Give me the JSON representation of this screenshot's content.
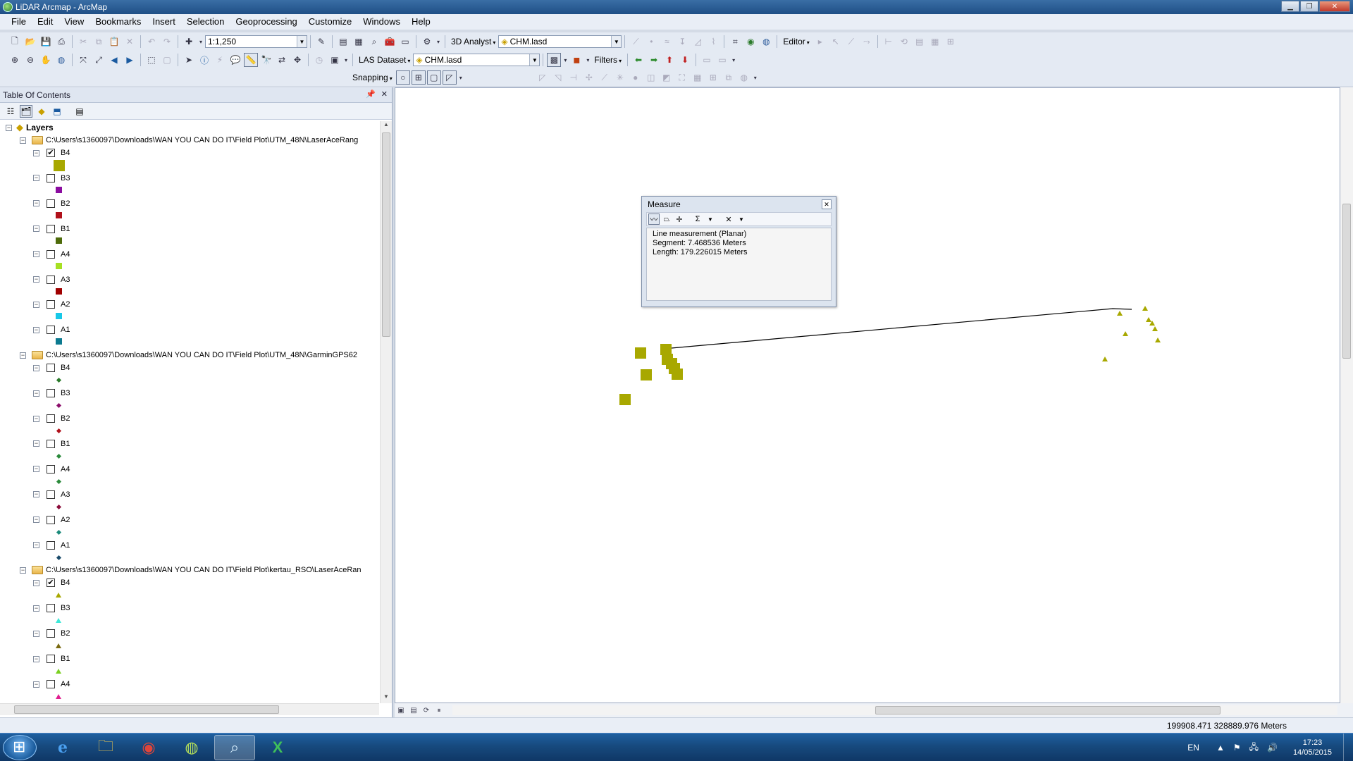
{
  "window": {
    "title": "LiDAR Arcmap - ArcMap"
  },
  "menubar": [
    "File",
    "Edit",
    "View",
    "Bookmarks",
    "Insert",
    "Selection",
    "Geoprocessing",
    "Customize",
    "Windows",
    "Help"
  ],
  "toolbar": {
    "scale": "1:1,250",
    "analyst_label": "3D Analyst",
    "analyst_layer": "CHM.lasd",
    "editor_label": "Editor",
    "las_label": "LAS Dataset",
    "las_layer": "CHM.lasd",
    "filters_label": "Filters",
    "snapping_label": "Snapping"
  },
  "toc": {
    "title": "Table Of Contents",
    "root": "Layers",
    "groups": [
      {
        "path": "C:\\Users\\s1360097\\Downloads\\WAN YOU CAN DO IT\\Field Plot\\UTM_48N\\LaserAceRang",
        "symbol": "square",
        "layers": [
          {
            "name": "B4",
            "checked": true,
            "color": "#a8a800",
            "big": true
          },
          {
            "name": "B3",
            "checked": false,
            "color": "#8b0ca0"
          },
          {
            "name": "B2",
            "checked": false,
            "color": "#b0101a"
          },
          {
            "name": "B1",
            "checked": false,
            "color": "#4e6b0a"
          },
          {
            "name": "A4",
            "checked": false,
            "color": "#a6e022"
          },
          {
            "name": "A3",
            "checked": false,
            "color": "#a00000"
          },
          {
            "name": "A2",
            "checked": false,
            "color": "#18c8e8"
          },
          {
            "name": "A1",
            "checked": false,
            "color": "#0c7a90"
          }
        ]
      },
      {
        "path": "C:\\Users\\s1360097\\Downloads\\WAN YOU CAN DO IT\\Field Plot\\UTM_48N\\GarminGPS62",
        "symbol": "diamond",
        "layers": [
          {
            "name": "B4",
            "checked": false,
            "color": "#2a7a2a"
          },
          {
            "name": "B3",
            "checked": false,
            "color": "#8b0c6a"
          },
          {
            "name": "B2",
            "checked": false,
            "color": "#b0101a"
          },
          {
            "name": "B1",
            "checked": false,
            "color": "#2a8a3a"
          },
          {
            "name": "A4",
            "checked": false,
            "color": "#2a8a3a"
          },
          {
            "name": "A3",
            "checked": false,
            "color": "#8b0c3a"
          },
          {
            "name": "A2",
            "checked": false,
            "color": "#1a8a7a"
          },
          {
            "name": "A1",
            "checked": false,
            "color": "#1a4a6a"
          }
        ]
      },
      {
        "path": "C:\\Users\\s1360097\\Downloads\\WAN YOU CAN DO IT\\Field Plot\\kertau_RSO\\LaserAceRan",
        "symbol": "triangle",
        "layers": [
          {
            "name": "B4",
            "checked": true,
            "color": "#a8a800"
          },
          {
            "name": "B3",
            "checked": false,
            "color": "#3ee8d8"
          },
          {
            "name": "B2",
            "checked": false,
            "color": "#7a6a10"
          },
          {
            "name": "B1",
            "checked": false,
            "color": "#7ad020"
          },
          {
            "name": "A4",
            "checked": false,
            "color": "#e02090"
          }
        ]
      }
    ]
  },
  "measure": {
    "title": "Measure",
    "line1": "Line measurement (Planar)",
    "line2": "Segment: 7.468536 Meters",
    "line3": "Length: 179.226015 Meters"
  },
  "status": {
    "coords": "199908.471  328889.976 Meters"
  },
  "taskbar": {
    "language": "EN",
    "time": "17:23",
    "date": "14/05/2015",
    "apps": [
      "ie-icon",
      "explorer-icon",
      "chrome-icon",
      "arcgis-icon",
      "arcmap-icon",
      "excel-icon"
    ]
  },
  "colors": {
    "feature": "#a8a800"
  }
}
